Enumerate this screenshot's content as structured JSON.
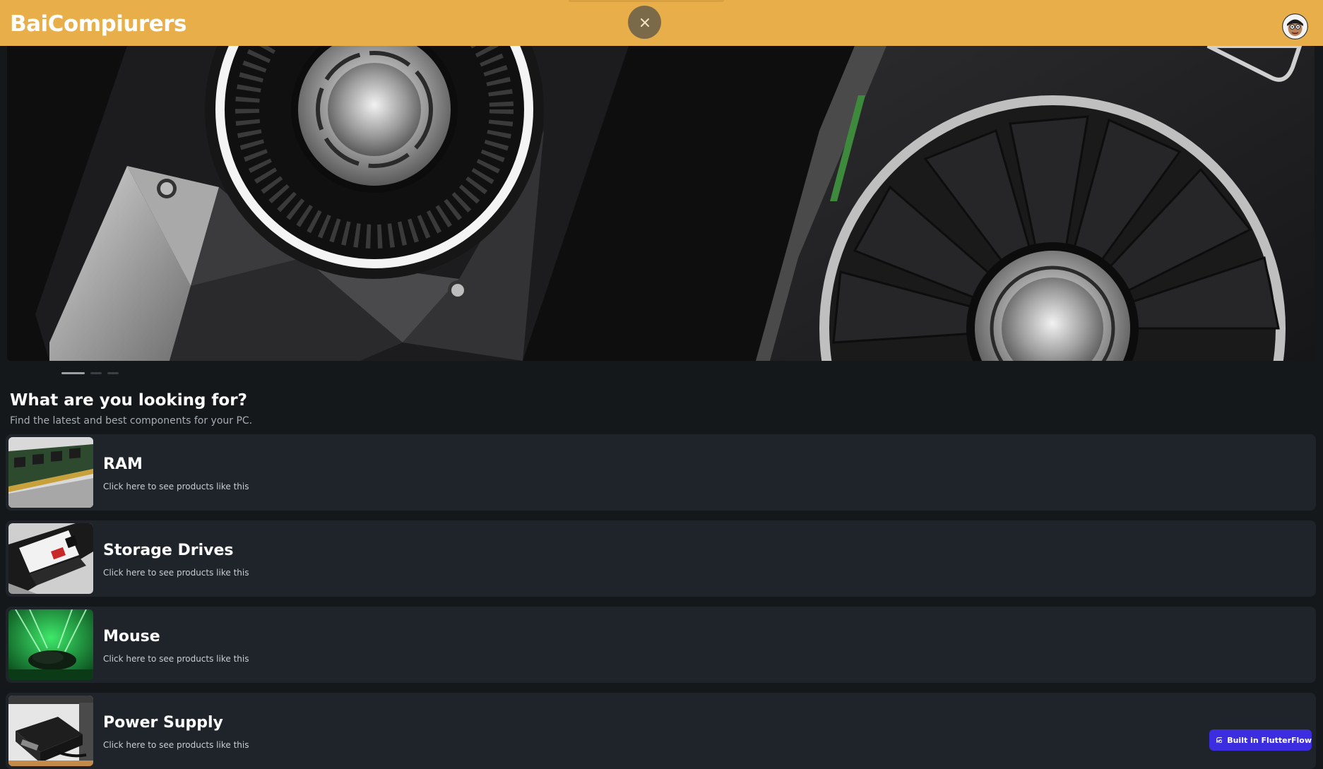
{
  "appbar": {
    "title": "BaiCompiurers",
    "background": "#e8ae4a",
    "close_icon": "close-icon",
    "avatar_icon": "user-avatar"
  },
  "hero": {
    "image": "graphics-card-fans-banner",
    "slide_count": 3,
    "active_slide": 1
  },
  "section": {
    "title": "What are you looking for?",
    "subtitle": "Find the latest and best components for your PC."
  },
  "categories": [
    {
      "name": "RAM",
      "description": "Click here to see products like this",
      "thumb": "ram-stick-image"
    },
    {
      "name": "Storage Drives",
      "description": "Click here to see products like this",
      "thumb": "ssd-image"
    },
    {
      "name": "Mouse",
      "description": "Click here to see products like this",
      "thumb": "gaming-mouse-image"
    },
    {
      "name": "Power Supply",
      "description": "Click here to see products like this",
      "thumb": "power-supply-image"
    }
  ],
  "badge": {
    "label": "Built in FlutterFlow",
    "background": "#3c2ee0"
  }
}
